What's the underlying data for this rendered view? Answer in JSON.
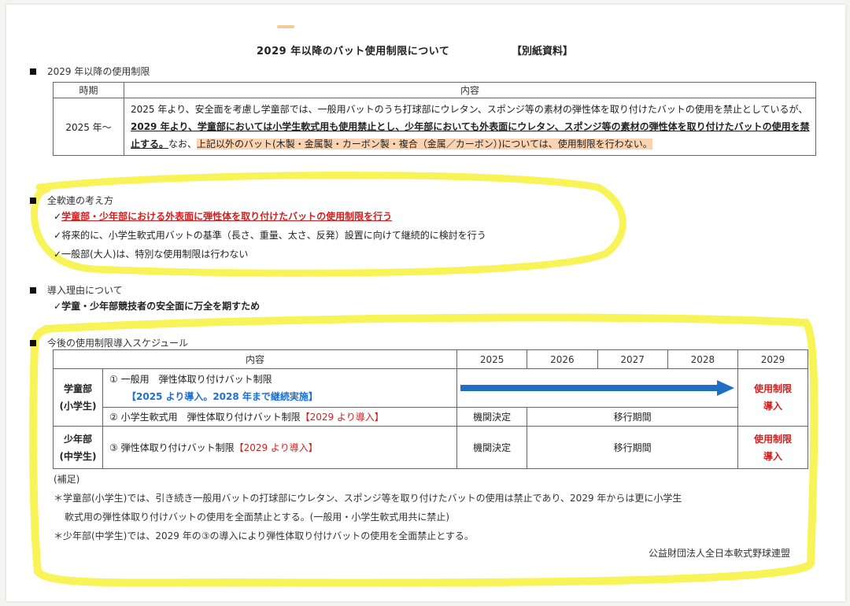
{
  "doc": {
    "title": "2029 年以降のバット使用制限について",
    "tag": "【別紙資料】"
  },
  "section1": {
    "heading": "2029 年以降の使用制限",
    "col_period": "時期",
    "col_content": "内容",
    "period": "2025 年～",
    "text_a": "2025 年より、安全面を考慮し学童部では、一般用バットのうち打球部にウレタン、スポンジ等の素材の弾性体を取り付けたバットの使用を禁止としているが、",
    "text_b": "2029 年より、学童部においては小学生軟式用も使用禁止とし、少年部においても外表面にウレタン、スポンジ等の素材の弾性体を取り付けたバットの使用を禁止する。",
    "text_c": "なお、",
    "text_d": "上記以外のバット(木製・金属製・カーボン製・複合（金属／カーボン）)については、使用制限を行わない。"
  },
  "section2": {
    "heading": "全軟連の考え方",
    "item1": "学童部・少年部における外表面に弾性体を取り付けたバットの使用制限を行う",
    "item2": "将来的に、小学生軟式用バットの基準（長さ、重量、太さ、反発）設置に向けて継続的に検討を行う",
    "item3": "一般部(大人)は、特別な使用制限は行わない"
  },
  "section3": {
    "heading": "導入理由について",
    "item1": "学童・少年部競技者の安全面に万全を期すため"
  },
  "section4": {
    "heading": "今後の使用制限導入スケジュール",
    "col_content": "内容",
    "years": [
      "2025",
      "2026",
      "2027",
      "2028",
      "2029"
    ],
    "group1": "学童部\n(小学生)",
    "group2": "少年部\n(中学生)",
    "row1_text": "① 一般用　弾性体取り付けバット制限",
    "row1_sub": "【2025 より導入。2028 年まで継続実施】",
    "row1_end": "使用制限\n導入",
    "row2_text": "② 小学生軟式用　弾性体取り付けバット制限",
    "row2_tag": "【2029 より導入】",
    "row2_start": "機関決定",
    "row2_mid": "移行期間",
    "row3_text": "③ 弾性体取り付けバット制限",
    "row3_tag": "【2029 より導入】",
    "row3_start": "機関決定",
    "row3_mid": "移行期間",
    "row3_end": "使用制限\n導入",
    "notes_title": "(補足)",
    "note1a": "＊学童部(小学生)では、引き続き一般用バットの打球部にウレタン、スポンジ等を取り付けたバットの使用は禁止であり、2029 年からは更に小学生",
    "note1b": "軟式用の弾性体取り付けバットの使用を全面禁止とする。(一般用・小学生軟式用共に禁止)",
    "note2": "＊少年部(中学生)では、2029 年の③の導入により弾性体取り付けバットの使用を全面禁止とする。",
    "org": "公益財団法人全日本軟式野球連盟"
  },
  "colors": {
    "highlight_yellow": "#f7f23a",
    "highlight_orange": "#fbd3b0",
    "red": "#d21f1f",
    "blue_arrow": "#1e6fc4"
  }
}
